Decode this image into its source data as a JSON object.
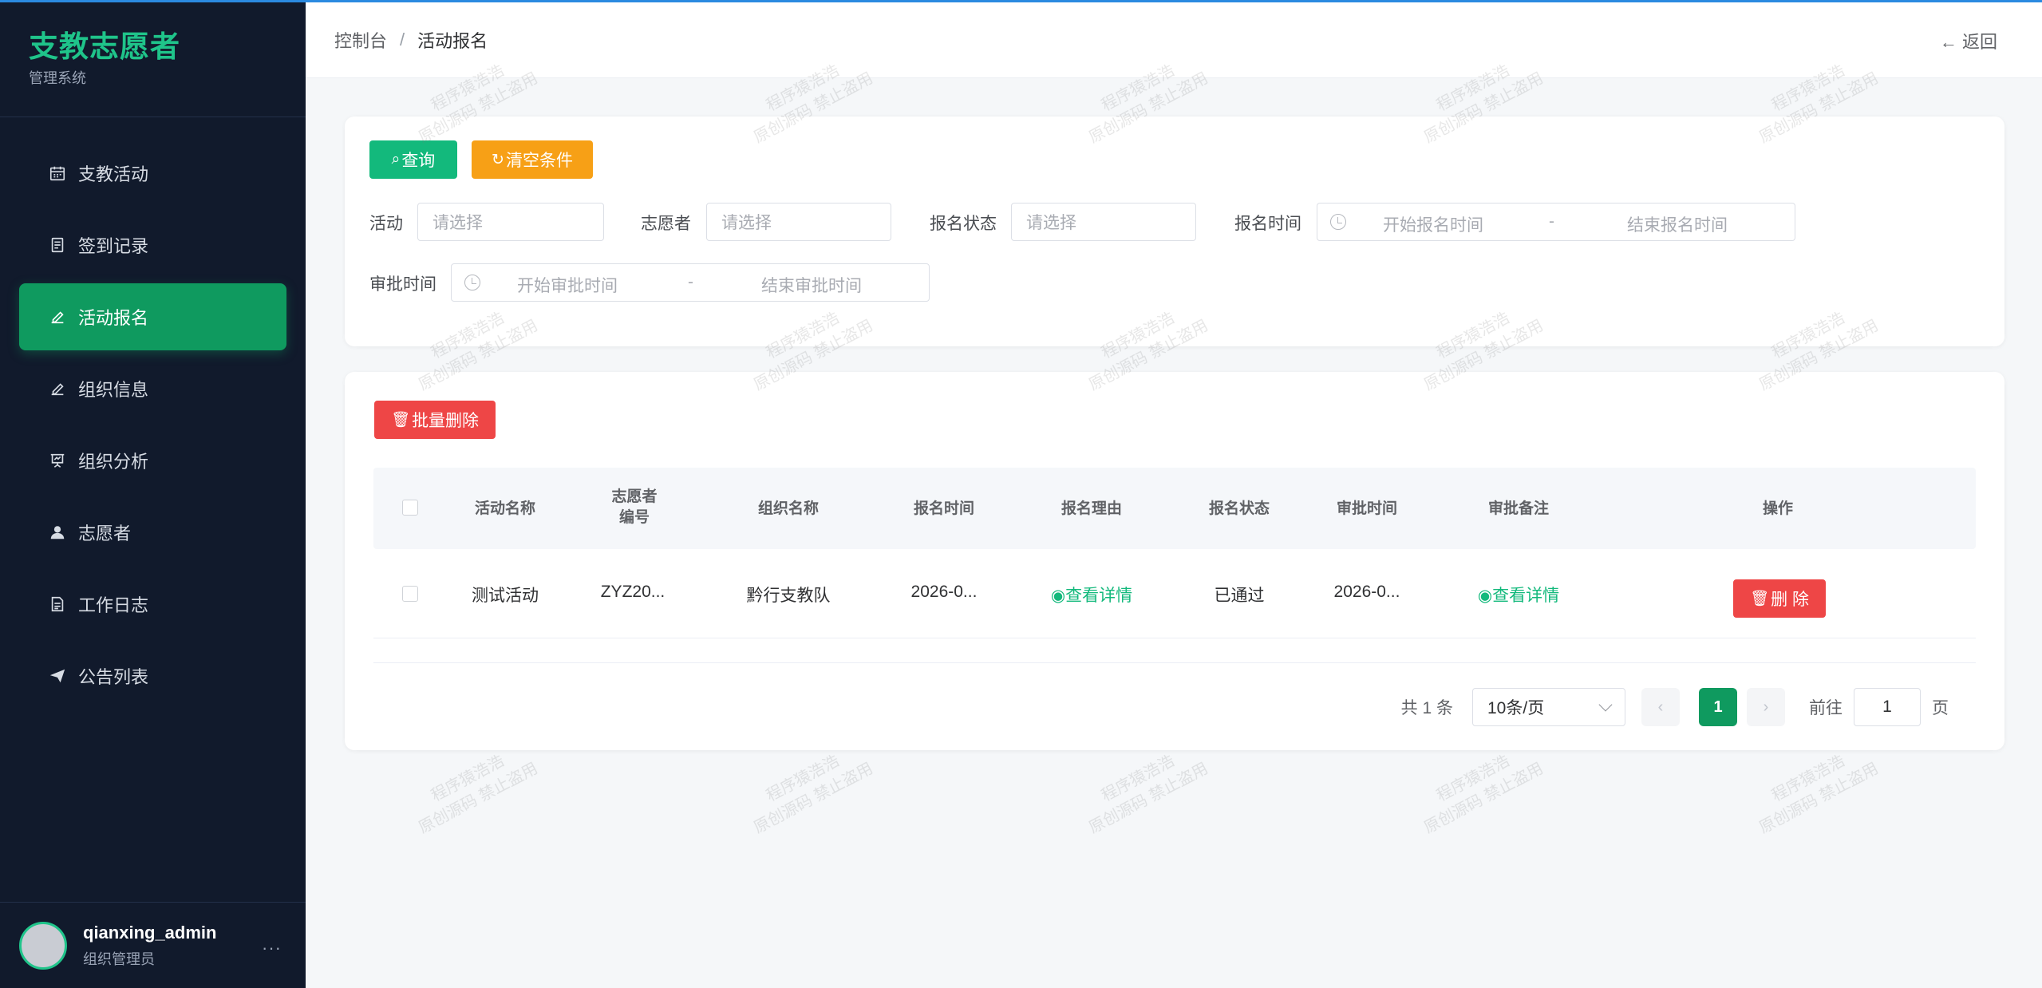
{
  "sidebar": {
    "brand_title": "支教志愿者",
    "brand_sub": "管理系统",
    "items": [
      {
        "label": "支教活动",
        "icon": "calendar-icon"
      },
      {
        "label": "签到记录",
        "icon": "document-icon"
      },
      {
        "label": "活动报名",
        "icon": "edit-icon",
        "active": true
      },
      {
        "label": "组织信息",
        "icon": "edit-icon"
      },
      {
        "label": "组织分析",
        "icon": "presentation-icon"
      },
      {
        "label": "志愿者",
        "icon": "user-icon"
      },
      {
        "label": "工作日志",
        "icon": "document-icon"
      },
      {
        "label": "公告列表",
        "icon": "send-icon"
      }
    ],
    "user": {
      "name": "qianxing_admin",
      "role": "组织管理员",
      "more": "···"
    }
  },
  "header": {
    "breadcrumb": [
      "控制台",
      "活动报名"
    ],
    "separator": "/",
    "back_label": "返回",
    "back_arrow": "←"
  },
  "filters": {
    "query_label": "查询",
    "clear_label": "清空条件",
    "activity_label": "活动",
    "activity_placeholder": "请选择",
    "volunteer_label": "志愿者",
    "volunteer_placeholder": "请选择",
    "status_label": "报名状态",
    "status_placeholder": "请选择",
    "signup_time_label": "报名时间",
    "signup_start": "开始报名时间",
    "signup_end": "结束报名时间",
    "approve_time_label": "审批时间",
    "approve_start": "开始审批时间",
    "approve_end": "结束审批时间",
    "range_sep": "-"
  },
  "table": {
    "batch_delete_label": "批量删除",
    "columns": [
      "活动名称",
      "志愿者编号",
      "组织名称",
      "报名时间",
      "报名理由",
      "报名状态",
      "审批时间",
      "审批备注",
      "操作"
    ],
    "rows": [
      {
        "activity": "测试活动",
        "volunteer_no": "ZYZ20...",
        "org": "黔行支教队",
        "signup_time": "2026-0...",
        "reason": "查看详情",
        "status": "已通过",
        "approve_time": "2026-0...",
        "remark": "查看详情",
        "delete_label": "删 除"
      }
    ]
  },
  "pagination": {
    "total_text": "共 1 条",
    "page_size": "10条/页",
    "prev": "‹",
    "next": "›",
    "current_page": "1",
    "goto_label": "前往",
    "goto_value": "1",
    "page_unit": "页"
  },
  "watermark": {
    "line1": "程序猿浩浩",
    "line2": "原创源码 禁止盗用"
  },
  "colors": {
    "primary": "#0f9a5f",
    "accent_green": "#13b97c",
    "orange": "#f7a016",
    "red": "#ee4646",
    "sidebar_bg": "#111a2c"
  }
}
